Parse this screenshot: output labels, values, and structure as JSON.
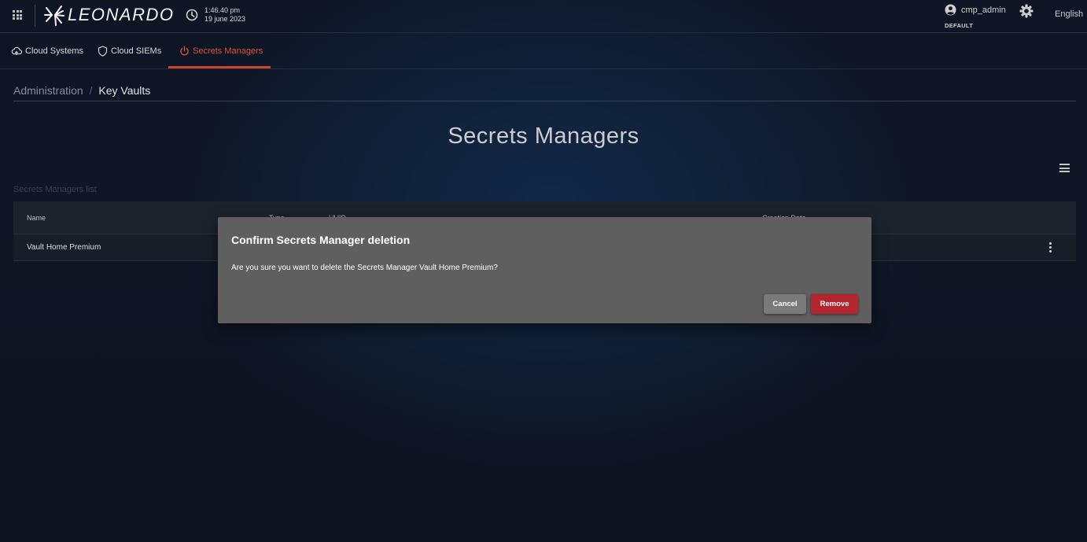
{
  "header": {
    "logo_text": "LEONARDO",
    "time": "1:46.40 pm",
    "date": "19 june 2023",
    "username": "cmp_admin",
    "tenant": "DEFAULT",
    "language": "English"
  },
  "tabs": [
    {
      "label": "Cloud Systems",
      "icon": "cloud-icon",
      "active": false
    },
    {
      "label": "Cloud SIEMs",
      "icon": "shield-icon",
      "active": false
    },
    {
      "label": "Secrets Managers",
      "icon": "power-icon",
      "active": true
    }
  ],
  "breadcrumb": {
    "parent": "Administration",
    "separator": "/",
    "current": "Key Vaults"
  },
  "page": {
    "title": "Secrets Managers",
    "list_caption": "Secrets Managers list"
  },
  "table": {
    "columns": [
      "Name",
      "Type",
      "UUID",
      "Creation Date"
    ],
    "rows": [
      {
        "name": "Vault Home Premium"
      }
    ]
  },
  "dialog": {
    "title": "Confirm Secrets Manager deletion",
    "message": "Are you sure you want to delete the Secrets Manager Vault Home Premium?",
    "cancel_label": "Cancel",
    "remove_label": "Remove"
  },
  "colors": {
    "accent": "#e8563c",
    "danger": "#b4262d",
    "dialog_bg": "#5f5f5f"
  }
}
